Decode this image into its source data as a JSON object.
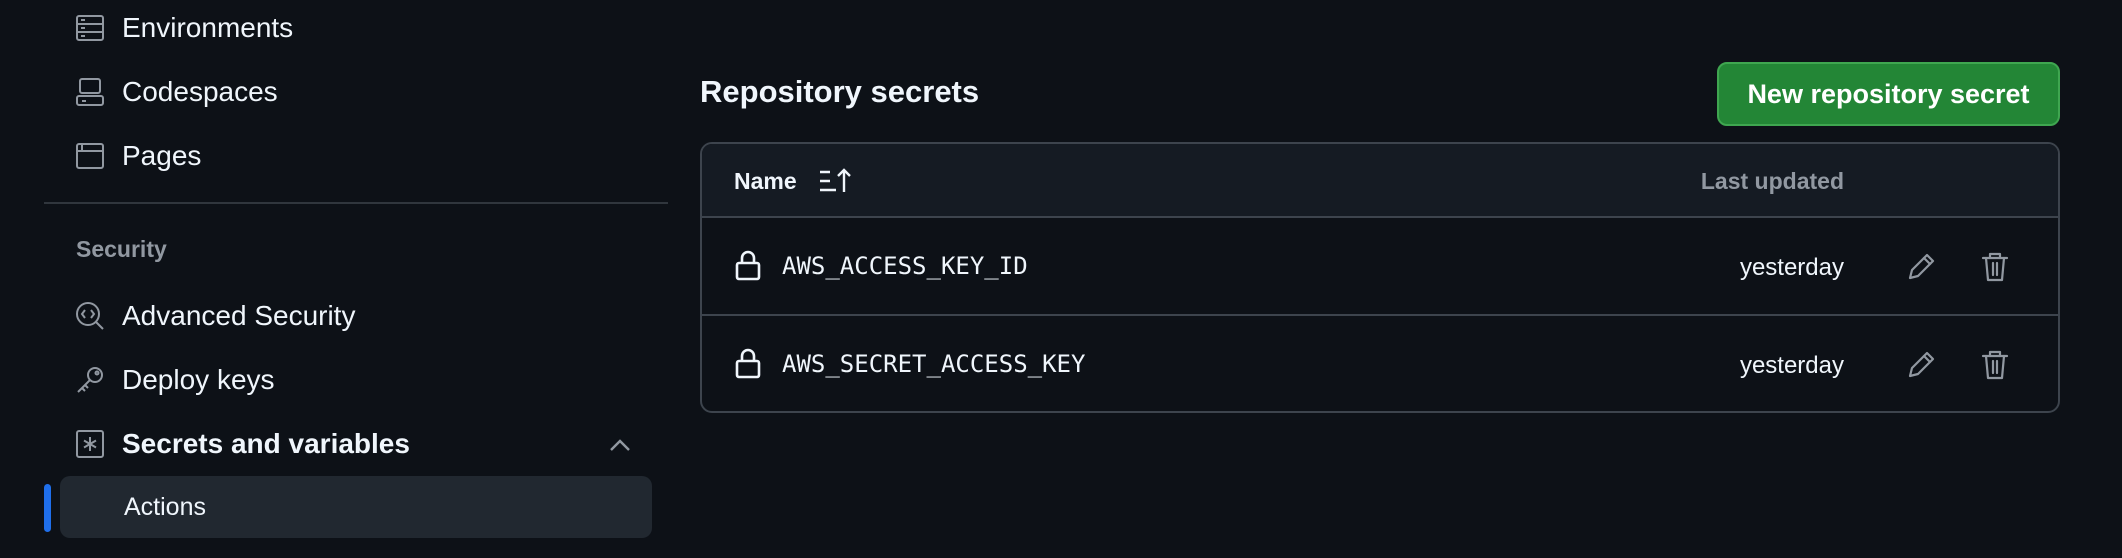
{
  "sidebar": {
    "items": [
      {
        "label": "Environments",
        "icon": "server-icon"
      },
      {
        "label": "Codespaces",
        "icon": "codespaces-icon"
      },
      {
        "label": "Pages",
        "icon": "browser-icon"
      }
    ],
    "security_heading": "Security",
    "security_items": [
      {
        "label": "Advanced Security",
        "icon": "codescan-icon"
      },
      {
        "label": "Deploy keys",
        "icon": "key-icon"
      },
      {
        "label": "Secrets and variables",
        "icon": "key-asterisk-icon",
        "expanded": true
      }
    ],
    "sub_items": [
      {
        "label": "Actions",
        "selected": true
      }
    ]
  },
  "main": {
    "title": "Repository secrets",
    "new_button_label": "New repository secret",
    "table": {
      "columns": {
        "name": "Name",
        "last_updated": "Last updated"
      },
      "rows": [
        {
          "name": "AWS_ACCESS_KEY_ID",
          "updated": "yesterday"
        },
        {
          "name": "AWS_SECRET_ACCESS_KEY",
          "updated": "yesterday"
        }
      ]
    }
  },
  "colors": {
    "background": "#0d1117",
    "accent_blue": "#1f6feb",
    "button_green": "#238636",
    "muted_text": "#9198a1",
    "border": "#3d444d"
  }
}
